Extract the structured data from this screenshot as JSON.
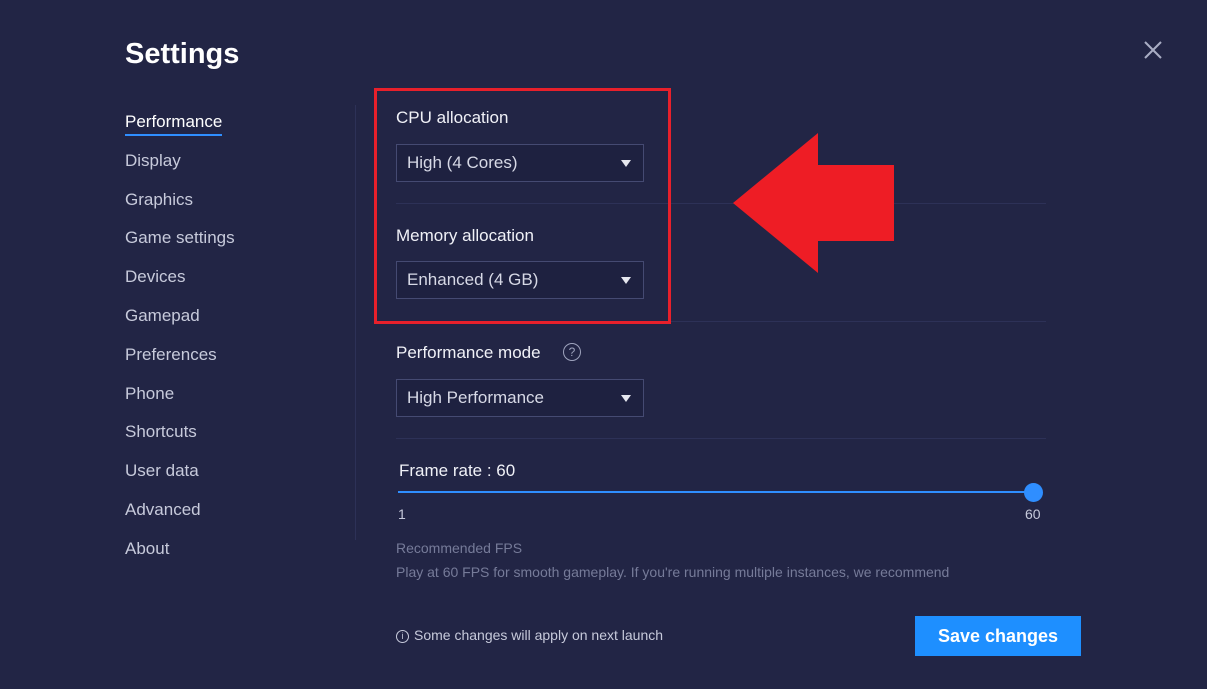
{
  "window": {
    "title": "Settings",
    "close_icon": "close-icon"
  },
  "sidebar": {
    "items": [
      {
        "label": "Performance",
        "active": true
      },
      {
        "label": "Display"
      },
      {
        "label": "Graphics"
      },
      {
        "label": "Game settings"
      },
      {
        "label": "Devices"
      },
      {
        "label": "Gamepad"
      },
      {
        "label": "Preferences"
      },
      {
        "label": "Phone"
      },
      {
        "label": "Shortcuts"
      },
      {
        "label": "User data"
      },
      {
        "label": "Advanced"
      },
      {
        "label": "About"
      }
    ]
  },
  "cpu": {
    "label": "CPU allocation",
    "value": "High (4 Cores)"
  },
  "memory": {
    "label": "Memory allocation",
    "value": "Enhanced (4 GB)"
  },
  "performance_mode": {
    "label": "Performance mode",
    "help_icon": "help-icon",
    "value": "High Performance"
  },
  "frame_rate": {
    "label": "Frame rate : 60",
    "value": 60,
    "min": 1,
    "max": 60,
    "min_label": "1",
    "max_label": "60"
  },
  "recommended": {
    "title": "Recommended FPS",
    "text": "Play at 60 FPS for smooth gameplay. If you're running multiple instances, we recommend"
  },
  "footer": {
    "note": "Some changes will apply on next launch",
    "note_icon": "info-icon",
    "save_label": "Save changes"
  },
  "annotation": {
    "highlight_color": "#e8202b",
    "arrow_icon": "arrow-left-icon"
  },
  "colors": {
    "background": "#222545",
    "accent": "#1e8fff",
    "highlight": "#e8202b"
  }
}
